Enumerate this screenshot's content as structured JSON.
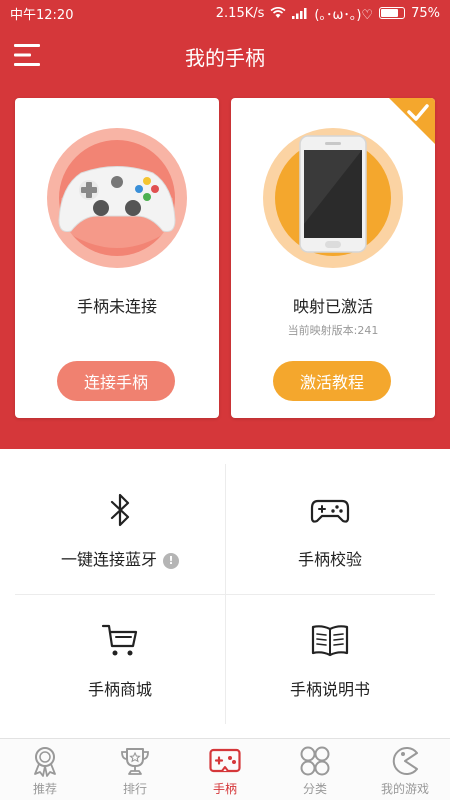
{
  "status_bar": {
    "time": "中午12:20",
    "speed": "2.15K/s",
    "emoticon": "(｡･ω･｡)♡",
    "battery": "75%"
  },
  "header": {
    "title": "我的手柄",
    "menu_icon": "hamburger-menu-icon"
  },
  "cards": {
    "controller": {
      "status": "手柄未连接",
      "button_label": "连接手柄",
      "icon": "gamepad-icon"
    },
    "mapping": {
      "status": "映射已激活",
      "version_text": "当前映射版本:241",
      "button_label": "激活教程",
      "icon": "phone-icon",
      "badge_icon": "checkmark-icon"
    }
  },
  "grid": [
    {
      "label": "一键连接蓝牙",
      "icon": "bluetooth-icon",
      "badge": "!"
    },
    {
      "label": "手柄校验",
      "icon": "gamepad-outline-icon"
    },
    {
      "label": "手柄商城",
      "icon": "shopping-cart-icon"
    },
    {
      "label": "手柄说明书",
      "icon": "book-icon"
    }
  ],
  "tabs": [
    {
      "label": "推荐",
      "icon": "medal-icon",
      "active": false
    },
    {
      "label": "排行",
      "icon": "trophy-icon",
      "active": false
    },
    {
      "label": "手柄",
      "icon": "gamepad-icon",
      "active": true
    },
    {
      "label": "分类",
      "icon": "clover-icon",
      "active": false
    },
    {
      "label": "我的游戏",
      "icon": "pacman-icon",
      "active": false
    }
  ],
  "colors": {
    "primary_red": "#d5373a",
    "salmon": "#f08170",
    "orange": "#f4a72d",
    "inactive": "#999999"
  }
}
